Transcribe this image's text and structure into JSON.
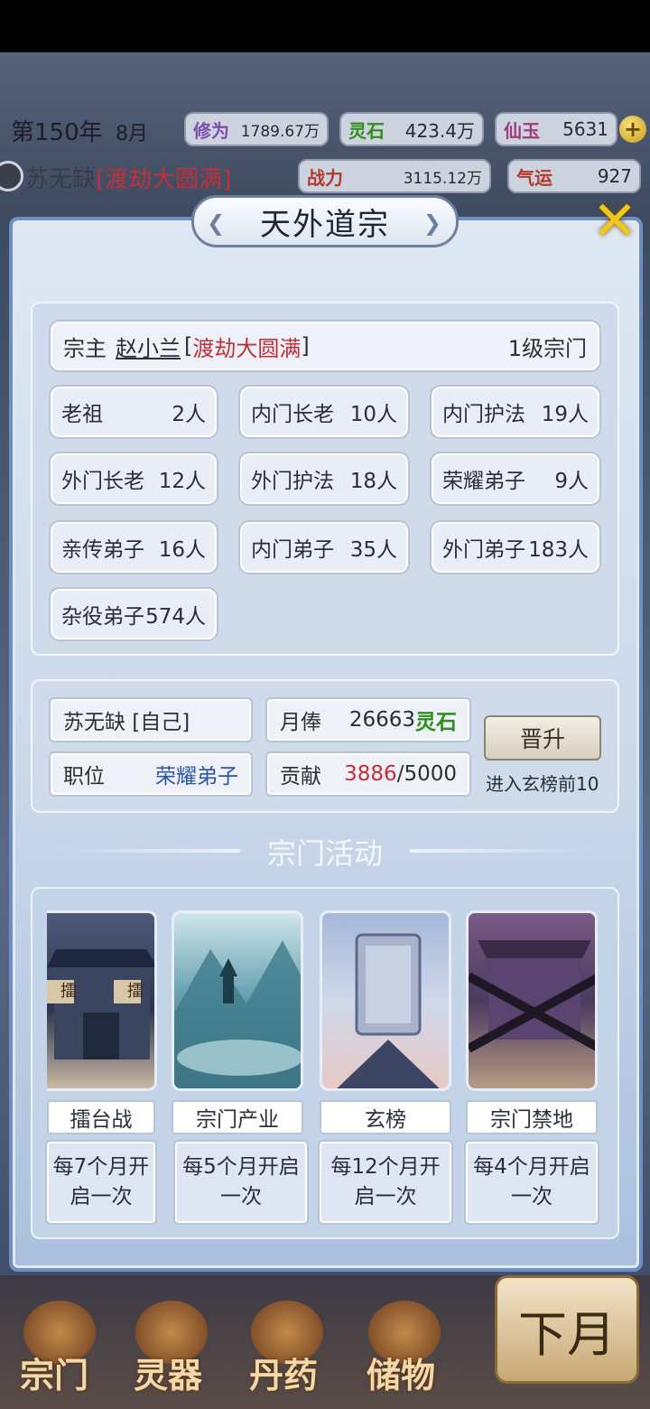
{
  "header": {
    "year": "第150年",
    "month": "8月",
    "cultivation_label": "修为",
    "cultivation_value": "1789.67万",
    "spirit_stone_label": "灵石",
    "spirit_stone_value": "423.4万",
    "jade_label": "仙玉",
    "jade_value": "5631",
    "add_symbol": "+",
    "player_name": "苏无缺",
    "player_realm": "[渡劫大圆满]",
    "power_label": "战力",
    "power_value": "3115.12万",
    "luck_label": "气运",
    "luck_value": "927"
  },
  "modal": {
    "title": "天外道宗",
    "close_symbol": "✕"
  },
  "leader": {
    "label": "宗主",
    "name": "赵小兰",
    "realm_open": "[",
    "realm": "渡劫大圆满",
    "realm_close": "]",
    "sect_level": "1级宗门"
  },
  "ranks": [
    {
      "label": "老祖",
      "count": "2人"
    },
    {
      "label": "内门长老",
      "count": "10人"
    },
    {
      "label": "内门护法",
      "count": "19人"
    },
    {
      "label": "外门长老",
      "count": "12人"
    },
    {
      "label": "外门护法",
      "count": "18人"
    },
    {
      "label": "荣耀弟子",
      "count": "9人"
    },
    {
      "label": "亲传弟子",
      "count": "16人"
    },
    {
      "label": "内门弟子",
      "count": "35人"
    },
    {
      "label": "外门弟子",
      "count": "183人"
    },
    {
      "label": "杂役弟子",
      "count": "574人"
    }
  ],
  "self": {
    "name": "苏无缺 [自己]",
    "salary_label": "月俸",
    "salary_value": "26663",
    "salary_unit": "灵石",
    "position_label": "职位",
    "position_value": "荣耀弟子",
    "contribution_label": "贡献",
    "contribution_current": "3886",
    "contribution_total": "/5000",
    "promote_button": "晋升",
    "promote_tip": "进入玄榜前10"
  },
  "activities_title": "宗门活动",
  "activities": [
    {
      "name": "擂台战",
      "schedule": "每7个月开启一次",
      "banner_text": "擂"
    },
    {
      "name": "宗门产业",
      "schedule": "每5个月开启一次"
    },
    {
      "name": "玄榜",
      "schedule": "每12个月开启一次"
    },
    {
      "name": "宗门禁地",
      "schedule": "每4个月开启一次"
    }
  ],
  "nav": {
    "sect": "宗门",
    "artifact": "灵器",
    "pill": "丹药",
    "storage": "储物",
    "next_month": "下月"
  },
  "colors": {
    "realm_red": "#c0303a",
    "position_blue": "#2c55a8",
    "spirit_stone_green": "#2f8c1e",
    "close_gold": "#f3c61a"
  }
}
